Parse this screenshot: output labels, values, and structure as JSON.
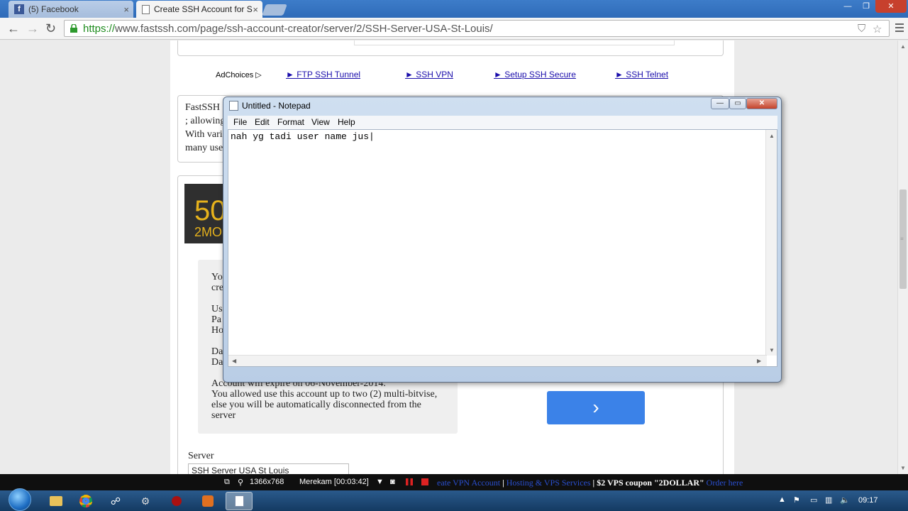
{
  "browser": {
    "tabs": [
      {
        "label": "(5) Facebook",
        "active": false
      },
      {
        "label": "Create SSH Account for S",
        "active": true
      }
    ],
    "window_controls": [
      "—",
      "❐",
      "✕"
    ],
    "url_scheme": "https://",
    "url_rest": "www.fastssh.com/page/ssh-account-creator/server/2/SSH-Server-USA-St-Louis/"
  },
  "page": {
    "adchoices": "AdChoices ▷",
    "ad_links": [
      "► FTP SSH Tunnel",
      "► SSH VPN",
      "► Setup SSH Secure",
      "► SSH Telnet"
    ],
    "intro_lines": [
      "FastSSH",
      "; allowing",
      "With vari",
      "many use"
    ],
    "promo_big": "50",
    "promo_small": "2MO",
    "account_lines": [
      "Yo",
      "cre",
      "",
      "Us",
      "Pa",
      "Ho",
      "",
      "Da",
      "Da",
      "",
      "Account will expire on 06-November-2014.",
      "You allowed use this account up to two (2) multi-bitvise,",
      "else you will be automatically disconnected from the",
      "server"
    ],
    "go_button": "›",
    "server_label": "Server",
    "server_value": "SSH Server USA St Louis"
  },
  "notepad": {
    "title": "Untitled - Notepad",
    "controls": [
      "—",
      "▭",
      "✕"
    ],
    "menu": [
      "File",
      "Edit",
      "Format",
      "View",
      "Help"
    ],
    "text": "nah yg tadi user name jus|"
  },
  "recorder": {
    "resolution": "1366x768",
    "status": "Merekam [00:03:42]",
    "marquee": [
      {
        "text": "eate VPN Account",
        "style": "blue"
      },
      {
        "text": " | ",
        "style": "white"
      },
      {
        "text": "Hosting & VPS Services",
        "style": "blue"
      },
      {
        "text": " | $2 VPS coupon \"2DOLLAR\" ",
        "style": "white"
      },
      {
        "text": "Order here",
        "style": "blue"
      }
    ]
  },
  "taskbar": {
    "clock": "09:17"
  }
}
